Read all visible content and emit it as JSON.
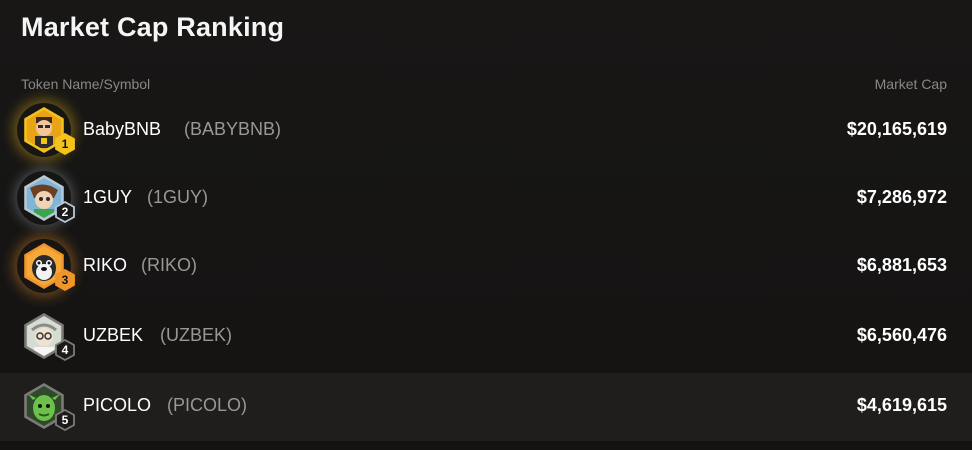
{
  "title": "Market Cap Ranking",
  "columns": {
    "name": "Token Name/Symbol",
    "cap": "Market Cap"
  },
  "colors": {
    "gold": "#f3c21c",
    "silver": "#b9c7d4",
    "bronze": "#f0952a",
    "default": "#7d7a77",
    "highlight_row": "#1f1e1c"
  },
  "tokens": [
    {
      "rank": "1",
      "name": "BabyBNB",
      "symbol": "(BABYBNB)",
      "market_cap": "$20,165,619",
      "avatar": "baby-bnb-avatar-icon"
    },
    {
      "rank": "2",
      "name": "1GUY",
      "symbol": "(1GUY)",
      "market_cap": "$7,286,972",
      "avatar": "1guy-avatar-icon"
    },
    {
      "rank": "3",
      "name": "RIKO",
      "symbol": "(RIKO)",
      "market_cap": "$6,881,653",
      "avatar": "riko-avatar-icon"
    },
    {
      "rank": "4",
      "name": "UZBEK",
      "symbol": "(UZBEK)",
      "market_cap": "$6,560,476",
      "avatar": "uzbek-avatar-icon"
    },
    {
      "rank": "5",
      "name": "PICOLO",
      "symbol": "(PICOLO)",
      "market_cap": "$4,619,615",
      "avatar": "picolo-avatar-icon"
    }
  ]
}
